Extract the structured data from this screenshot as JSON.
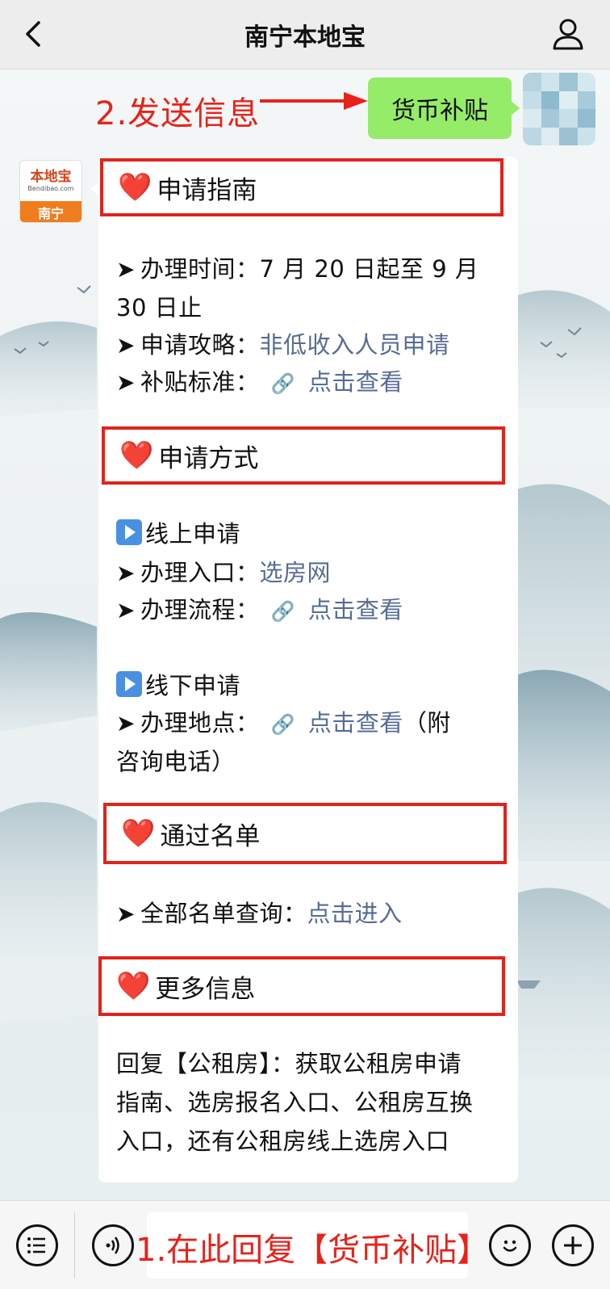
{
  "header": {
    "title": "南宁本地宝",
    "back_icon": "chevron-left-icon",
    "profile_icon": "user-icon"
  },
  "sent_message": {
    "annotation": "2.发送信息",
    "text": "货币补贴"
  },
  "bot_avatar": {
    "brand": "本地宝",
    "domain": "Bendibao.com",
    "city": "南宁"
  },
  "reply": {
    "sections": [
      {
        "title": "申请指南",
        "heart": "❤️"
      },
      {
        "title": "申请方式",
        "heart": "❤️"
      },
      {
        "title": "通过名单",
        "heart": "❤️"
      },
      {
        "title": "更多信息",
        "heart": "❤️"
      }
    ],
    "guide": {
      "time_label": "办理时间：",
      "time_value_1": "7 月 20 日起至 9 月",
      "time_value_2": "30 日止",
      "strategy_label": "申请攻略：",
      "strategy_link": "非低收入人员申请",
      "standard_label": "补贴标准：",
      "standard_link": "点击查看"
    },
    "methods": {
      "online_title": "线上申请",
      "entry_label": "办理入口：",
      "entry_link": "选房网",
      "process_label": "办理流程：",
      "process_link": "点击查看",
      "offline_title": "线下申请",
      "location_label": "办理地点：",
      "location_link": "点击查看",
      "location_suffix": "（附",
      "location_suffix_2": "咨询电话）"
    },
    "list": {
      "query_label": "全部名单查询：",
      "query_link": "点击进入"
    },
    "more": {
      "line1": "回复【公租房】：获取公租房申请",
      "line2": "指南、选房报名入口、公租房互换",
      "line3": "入口，还有公租房线上选房入口"
    }
  },
  "input_bar": {
    "annotation": "1.在此回复【货币补贴】",
    "menu_icon": "menu-list-icon",
    "voice_icon": "voice-icon",
    "emoji_icon": "emoji-icon",
    "plus_icon": "plus-icon"
  },
  "colors": {
    "accent_red": "#e2231a",
    "link_blue": "#576b95",
    "sent_bubble": "#95ec69"
  }
}
